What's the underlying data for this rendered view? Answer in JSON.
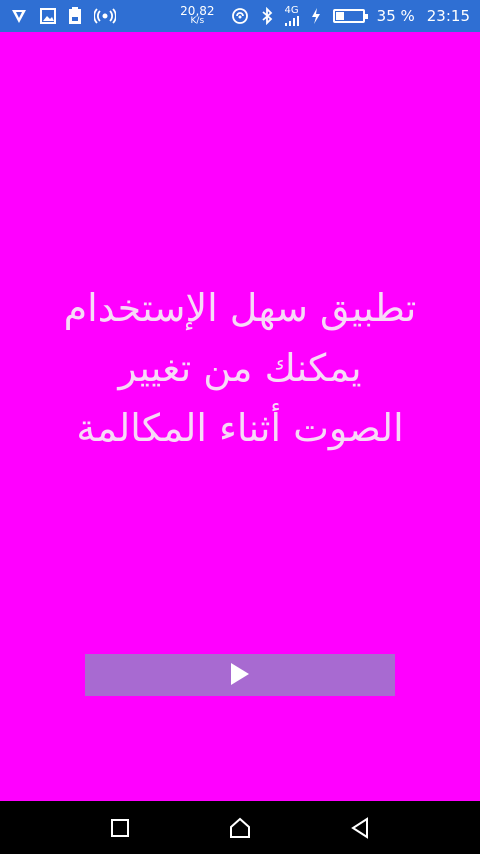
{
  "status_bar": {
    "net_speed_value": "20,82",
    "net_speed_unit": "K/s",
    "network_type": "4G",
    "battery_percent": "35 %",
    "battery_level": 0.35,
    "time": "23:15",
    "icons": [
      "vpn-shield-icon",
      "gallery-icon",
      "save-icon",
      "hotspot-icon",
      "nfc-icon",
      "bluetooth-icon",
      "signal-icon",
      "charging-icon",
      "battery-icon"
    ]
  },
  "main": {
    "background": "#ff00ff",
    "message_lines": [
      "تطبيق سهل الإستخدام",
      "يمكنك من تغيير",
      "الصوت أثناء المكالمة"
    ],
    "play_button": {
      "icon": "play-icon",
      "color": "#a86ad1"
    }
  },
  "nav_bar": {
    "buttons": [
      "recents-icon",
      "home-icon",
      "back-icon"
    ]
  }
}
